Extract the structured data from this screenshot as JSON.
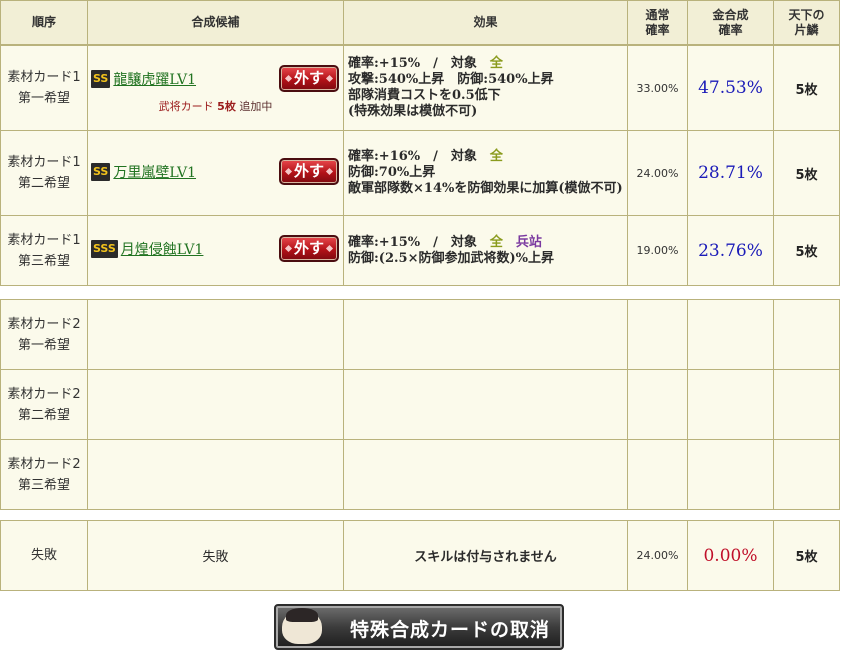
{
  "header": {
    "order": "順序",
    "candidate": "合成候補",
    "effect": "効果",
    "normal_rate_l1": "通常",
    "normal_rate_l2": "確率",
    "gold_rate_l1": "金合成",
    "gold_rate_l2": "確率",
    "scale_l1": "天下の",
    "scale_l2": "片鱗"
  },
  "group1": {
    "rows": [
      {
        "order_l1": "素材カード1",
        "order_l2": "第一希望",
        "rank": "SS",
        "skill": "龍驤虎躍LV1",
        "remove_label": "外す",
        "extra_prefix": "武将カード",
        "extra_count": "5枚",
        "extra_suffix": "追加中",
        "effect_line1_prefix": "確率:+15%　/　対象　",
        "effect_line1_target": "全",
        "effect_line2": "攻撃:540%上昇　防御:540%上昇",
        "effect_line3": "部隊消費コストを0.5低下",
        "effect_line4": "(特殊効果は模倣不可)",
        "normal_rate": "33.00%",
        "gold_rate": "47.53%",
        "scale": "5枚"
      },
      {
        "order_l1": "素材カード1",
        "order_l2": "第二希望",
        "rank": "SS",
        "skill": "万里嵐壁LV1",
        "remove_label": "外す",
        "effect_line1_prefix": "確率:+16%　/　対象　",
        "effect_line1_target": "全",
        "effect_line2": "防御:70%上昇",
        "effect_line3": "敵軍部隊数×14%を防御効果に加算(模倣不可)",
        "normal_rate": "24.00%",
        "gold_rate": "28.71%",
        "scale": "5枚"
      },
      {
        "order_l1": "素材カード1",
        "order_l2": "第三希望",
        "rank": "SSS",
        "skill": "月煌侵蝕LV1",
        "remove_label": "外す",
        "effect_line1_prefix": "確率:+15%　/　対象　",
        "effect_line1_target": "全",
        "effect_line1_target2": "兵站",
        "effect_line2": "防御:(2.5×防御参加武将数)%上昇",
        "normal_rate": "19.00%",
        "gold_rate": "23.76%",
        "scale": "5枚"
      }
    ]
  },
  "group2": {
    "rows": [
      {
        "order_l1": "素材カード2",
        "order_l2": "第一希望"
      },
      {
        "order_l1": "素材カード2",
        "order_l2": "第二希望"
      },
      {
        "order_l1": "素材カード2",
        "order_l2": "第三希望"
      }
    ]
  },
  "fail": {
    "order": "失敗",
    "candidate": "失敗",
    "effect": "スキルは付与されません",
    "normal_rate": "24.00%",
    "gold_rate": "0.00%",
    "scale": "5枚"
  },
  "cancel_button": {
    "label": "特殊合成カードの取消"
  },
  "colors": {
    "header_bg": "#f2efd6",
    "cell_bg": "#fbfaeb",
    "border": "#b9b27c",
    "skill_link": "#217321",
    "gold_rate": "#1b1bb8",
    "fail_rate": "#c0102a",
    "remove_button": "#b31218"
  }
}
